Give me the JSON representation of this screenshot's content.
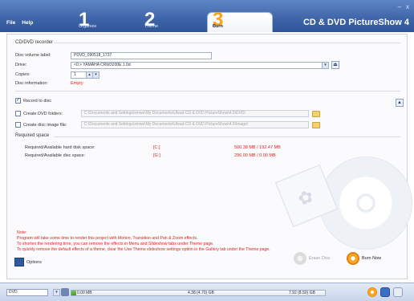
{
  "menu": {
    "file": "File",
    "help": "Help"
  },
  "window_controls": {
    "minimize": "–",
    "close": "x"
  },
  "app_title": "CD & DVD PictureShow 4",
  "steps": [
    {
      "num": "1",
      "label": "Organize"
    },
    {
      "num": "2",
      "label": "Theme"
    },
    {
      "num": "3",
      "label": "Burn"
    }
  ],
  "recorder": {
    "section_title": "CD/DVD recorder",
    "volume_label_lbl": "Disc volume label:",
    "volume_label_value": "PDVD_090518_1737",
    "drive_lbl": "Drive:",
    "drive_value": "<0:> YAMAHA CRW3200E 1.0d",
    "copies_lbl": "Copies:",
    "copies_value": "1",
    "disc_info_lbl": "Disc information:",
    "disc_info_value": "Empty"
  },
  "output": {
    "record_to_disc": "Record to disc",
    "create_dvd_folders": "Create DVD folders:",
    "dvd_folders_path": "C:\\Documents and Settings\\xmwe\\My Documents\\Ulead CD & DVD PictureShow\\4.0\\DVD\\",
    "create_image_file": "Create disc image file:",
    "image_file_path": "C:\\Documents and Settings\\xmwe\\My Documents\\Ulead CD & DVD PictureShow\\4.0\\Image\\"
  },
  "required_space": {
    "section_title": "Required space",
    "hard_disk_lbl": "Required/Available hard disk space:",
    "hard_disk_drive": "[C:]",
    "hard_disk_value": "500.38 MB  /  192.47 MB",
    "disc_lbl": "Required/Available disc space:",
    "disc_drive": "[G:]",
    "disc_value": "296.00 MB  /  0.00 MB"
  },
  "note": {
    "title": "Note:",
    "line1": "Program will take some time to render this project with Motion, Transition and Pan & Zoom effects.",
    "line2": "To shorten the rendering time, you can remove the effects in Menu and Slideshow tabs under Theme page.",
    "line3": "To quickly remove the default effects of a theme, clear the Use Theme slideshow settings option in the Gallery tab under the Theme page."
  },
  "buttons": {
    "options": "Options",
    "erase_disc": "Erase Disc",
    "burn_now": "Burn Now"
  },
  "status_bar": {
    "disc_type": "DVD",
    "used": "0.00 MB",
    "mid_capacity": "4.38 (4.70) GB",
    "max_capacity": "7.92 (8.50) GB",
    "progress_fraction": 0.02
  },
  "colors": {
    "accent": "#3e64a8",
    "warning": "#e02020",
    "burn_step": "#f7a21b"
  }
}
